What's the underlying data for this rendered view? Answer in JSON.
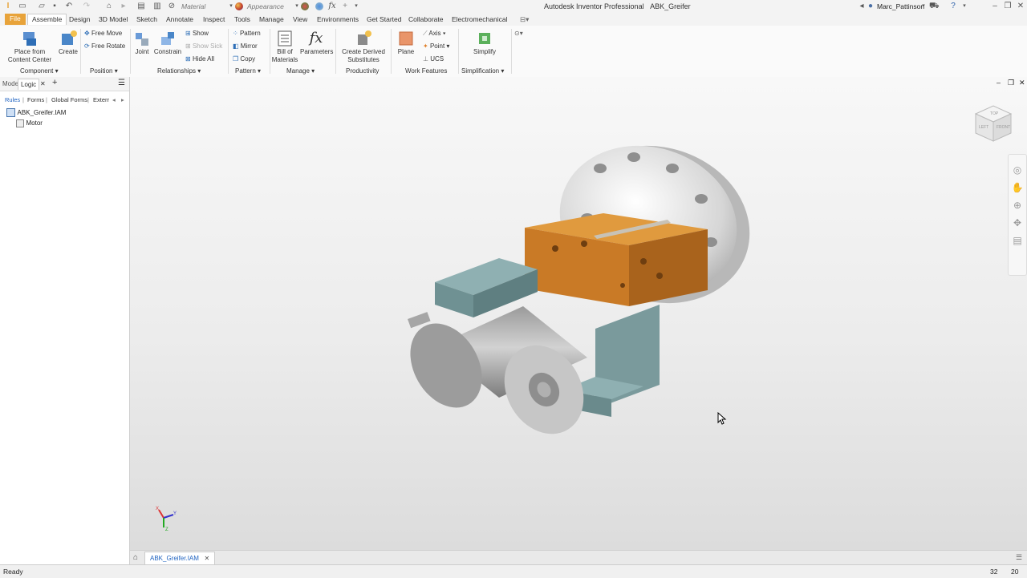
{
  "window": {
    "title": "Autodesk Inventor Professional",
    "document": "ABK_Greifer",
    "user": "Marc_Pattinson",
    "quick_access": {
      "material": "Material",
      "appearance": "Appearance"
    }
  },
  "tabs": [
    "File",
    "Assemble",
    "Design",
    "3D Model",
    "Sketch",
    "Annotate",
    "Inspect",
    "Tools",
    "Manage",
    "View",
    "Environments",
    "Get Started",
    "Collaborate",
    "Electromechanical"
  ],
  "active_tab": "Assemble",
  "ribbon": {
    "component": {
      "place_line1": "Place from",
      "place_line2": "Content Center",
      "create": "Create",
      "label": "Component"
    },
    "position": {
      "free_move": "Free Move",
      "free_rotate": "Free Rotate",
      "label": "Position"
    },
    "relationships": {
      "joint": "Joint",
      "constrain": "Constrain",
      "show": "Show",
      "show_sick": "Show Sick",
      "hide_all": "Hide All",
      "label": "Relationships"
    },
    "pattern": {
      "pattern": "Pattern",
      "mirror": "Mirror",
      "copy": "Copy",
      "label": "Pattern"
    },
    "manage": {
      "bom_line1": "Bill of",
      "bom_line2": "Materials",
      "parameters": "Parameters",
      "label": "Manage"
    },
    "productivity": {
      "derived_line1": "Create Derived",
      "derived_line2": "Substitutes",
      "label": "Productivity"
    },
    "work_features": {
      "plane": "Plane",
      "axis": "Axis",
      "point": "Point",
      "ucs": "UCS",
      "label": "Work Features"
    },
    "simplification": {
      "simplify": "Simplify",
      "label": "Simplification"
    }
  },
  "browser": {
    "tabs": [
      "Model",
      "Logic"
    ],
    "active_tab": "Logic",
    "subtabs": [
      "Rules",
      "Forms",
      "Global Forms",
      "Exterr"
    ],
    "tree": [
      {
        "label": "ABK_Greifer.IAM",
        "level": 0
      },
      {
        "label": "Motor",
        "level": 1
      }
    ]
  },
  "viewcube": {
    "top": "TOP",
    "left": "LEFT",
    "front": "FRONT"
  },
  "triad": {
    "x": "X",
    "y": "Y",
    "z": "Z"
  },
  "document_tab": "ABK_Greifer.IAM",
  "status": {
    "text": "Ready",
    "count1": "32",
    "count2": "20"
  },
  "colors": {
    "accent": "#e8a33a",
    "link": "#1e62c0",
    "steel": "#b8b8b8",
    "orange_part": "#d98a2b",
    "teal_part": "#7d9ea0"
  }
}
